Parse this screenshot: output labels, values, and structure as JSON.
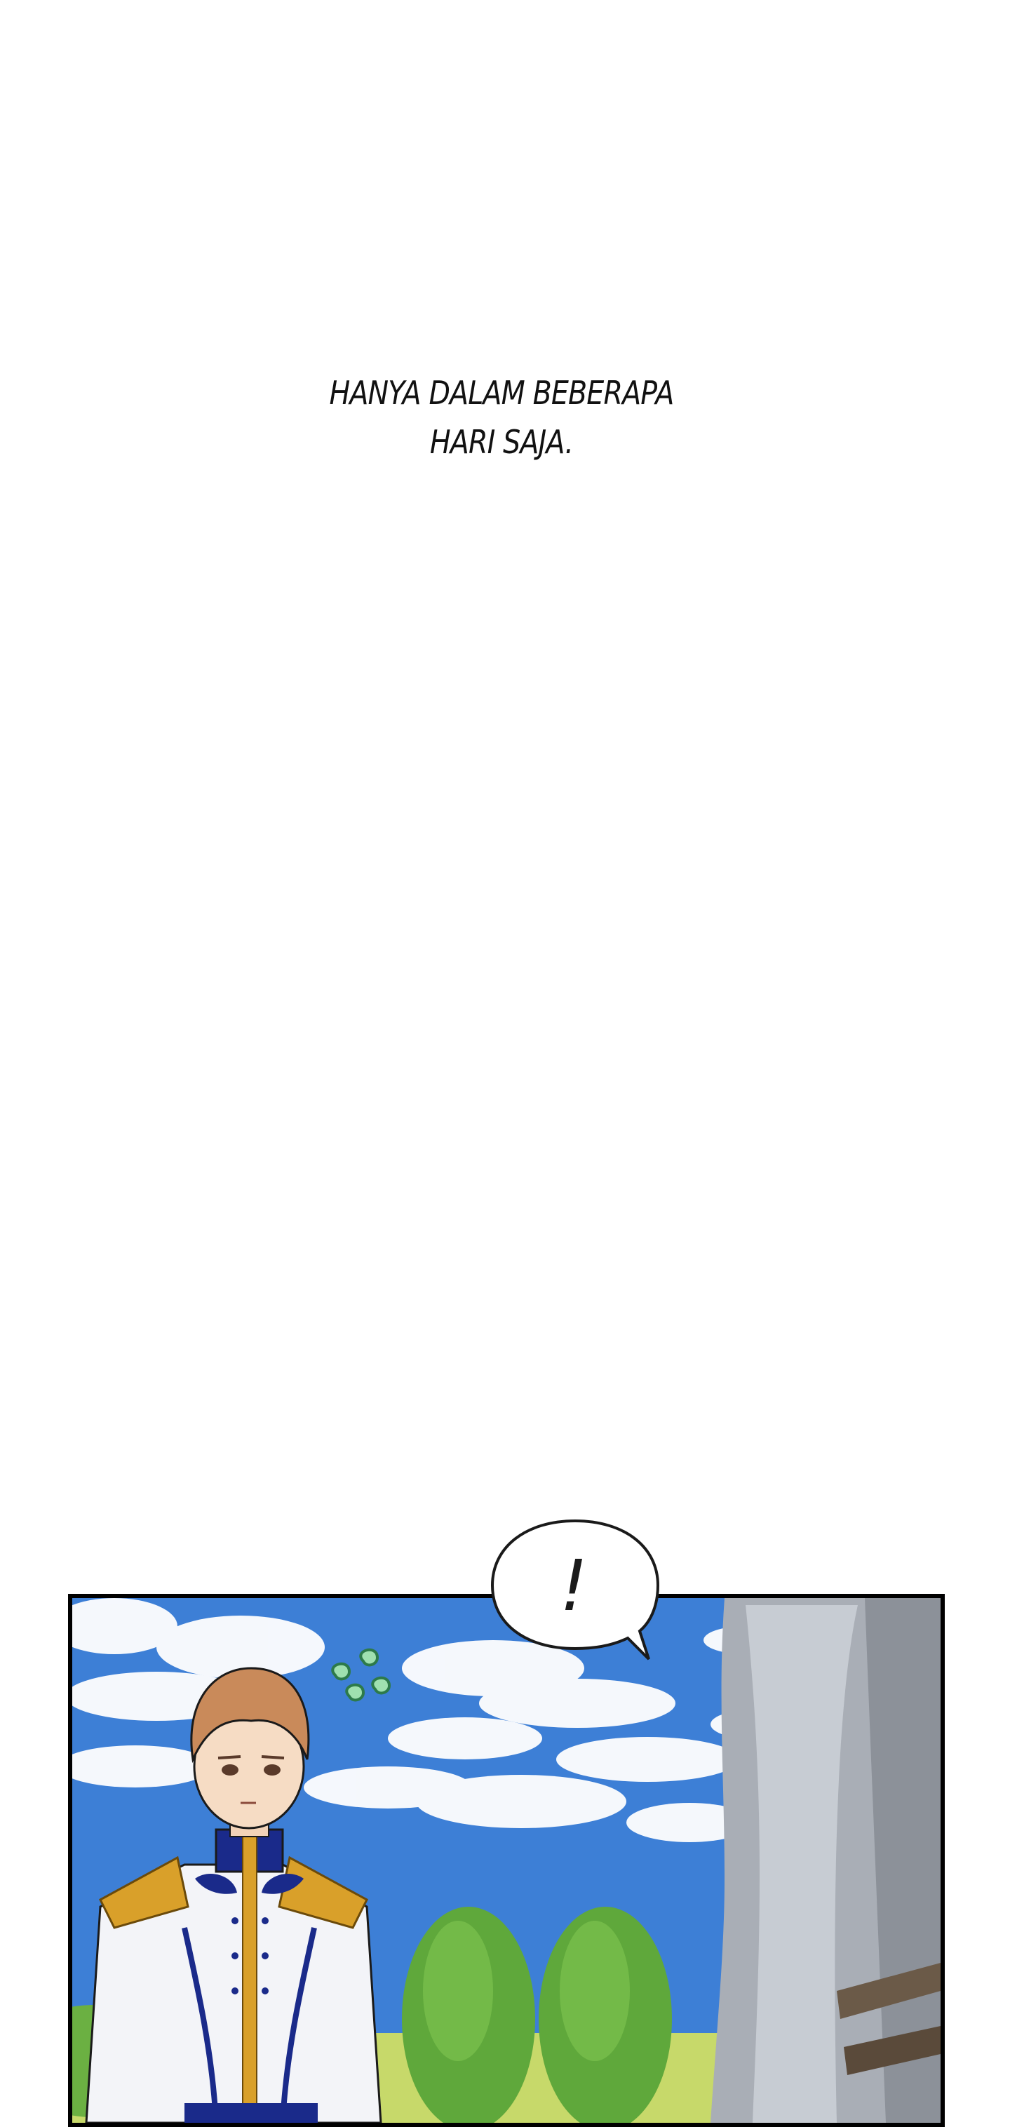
{
  "caption": {
    "line1": "HANYA DALAM BEBERAPA",
    "line2": "HARI SAJA."
  },
  "bubble": {
    "text": "!"
  },
  "colors": {
    "sky": "#3d7fd6",
    "panel_border": "#000000",
    "uniform_gold": "#d9a02a",
    "uniform_navy": "#1a2a8a",
    "hair": "#c98a5a",
    "trees": "#5fa83b"
  },
  "icons": [
    "speech-bubble-icon",
    "sweat-drops-icon"
  ]
}
